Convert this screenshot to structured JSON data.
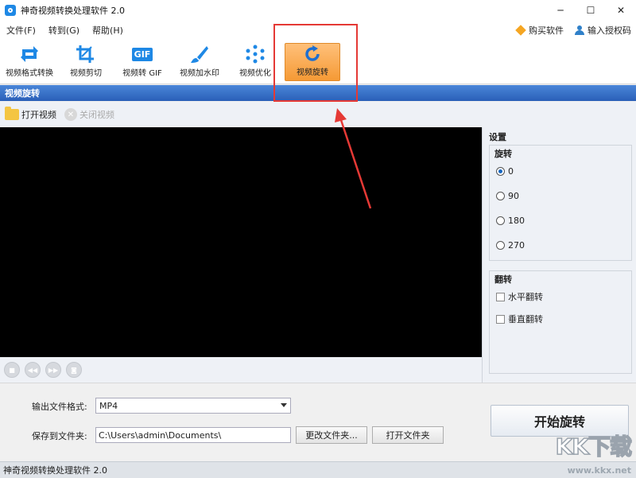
{
  "window": {
    "title": "神奇视频转换处理软件 2.0",
    "min": "─",
    "max": "☐",
    "close": "✕"
  },
  "menu": {
    "items": [
      {
        "label": "文件(F)"
      },
      {
        "label": "转到(G)"
      },
      {
        "label": "帮助(H)"
      }
    ],
    "buy": "购买软件",
    "license": "输入授权码"
  },
  "toolbar": {
    "tools": [
      {
        "label": "视频格式转换",
        "icon": "convert-icon"
      },
      {
        "label": "视频剪切",
        "icon": "crop-icon"
      },
      {
        "label": "视频转 GIF",
        "icon": "gif-icon"
      },
      {
        "label": "视频加水印",
        "icon": "brush-icon"
      },
      {
        "label": "视频优化",
        "icon": "optimize-icon"
      },
      {
        "label": "视频旋转",
        "icon": "rotate-icon"
      }
    ],
    "gif_text": "GIF"
  },
  "section": {
    "title": "视频旋转"
  },
  "subtoolbar": {
    "open": "打开视频",
    "close": "关闭视频"
  },
  "player": {
    "controls": [
      "stop",
      "rewind",
      "forward",
      "snapshot"
    ]
  },
  "settings": {
    "title": "设置",
    "rotate_group": "旋转",
    "rotate_options": [
      "0",
      "90",
      "180",
      "270"
    ],
    "rotate_selected": "0",
    "flip_group": "翻转",
    "flip_options": [
      "水平翻转",
      "垂直翻转"
    ]
  },
  "output": {
    "format_label": "输出文件格式:",
    "format_value": "MP4",
    "save_label": "保存到文件夹:",
    "save_path": "C:\\Users\\admin\\Documents\\",
    "change_folder": "更改文件夹...",
    "open_folder": "打开文件夹",
    "start": "开始旋转"
  },
  "status": {
    "text": "神奇视频转换处理软件 2.0"
  },
  "watermark": {
    "logo": "KK下载",
    "url": "www.kkx.net"
  },
  "colors": {
    "accent": "#2a5fb8",
    "active_tool": "#f59a35",
    "highlight": "#e53935"
  }
}
